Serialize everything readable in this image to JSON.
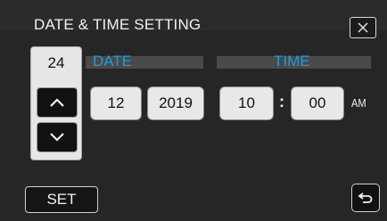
{
  "screen": {
    "title": "DATE & TIME SETTING",
    "close_icon": "close-x-icon",
    "back_icon": "return-arrow-icon"
  },
  "date": {
    "label": "DATE",
    "day": "24",
    "month": "12",
    "year": "2019"
  },
  "time": {
    "label": "TIME",
    "hour": "10",
    "separator": ":",
    "minute": "00",
    "period": "AM"
  },
  "controls": {
    "set_label": "SET",
    "up_icon": "chevron-up-icon",
    "down_icon": "chevron-down-icon"
  },
  "colors": {
    "accent": "#1f9be0",
    "background": "#262626",
    "button_light": "#e8e8e8"
  }
}
